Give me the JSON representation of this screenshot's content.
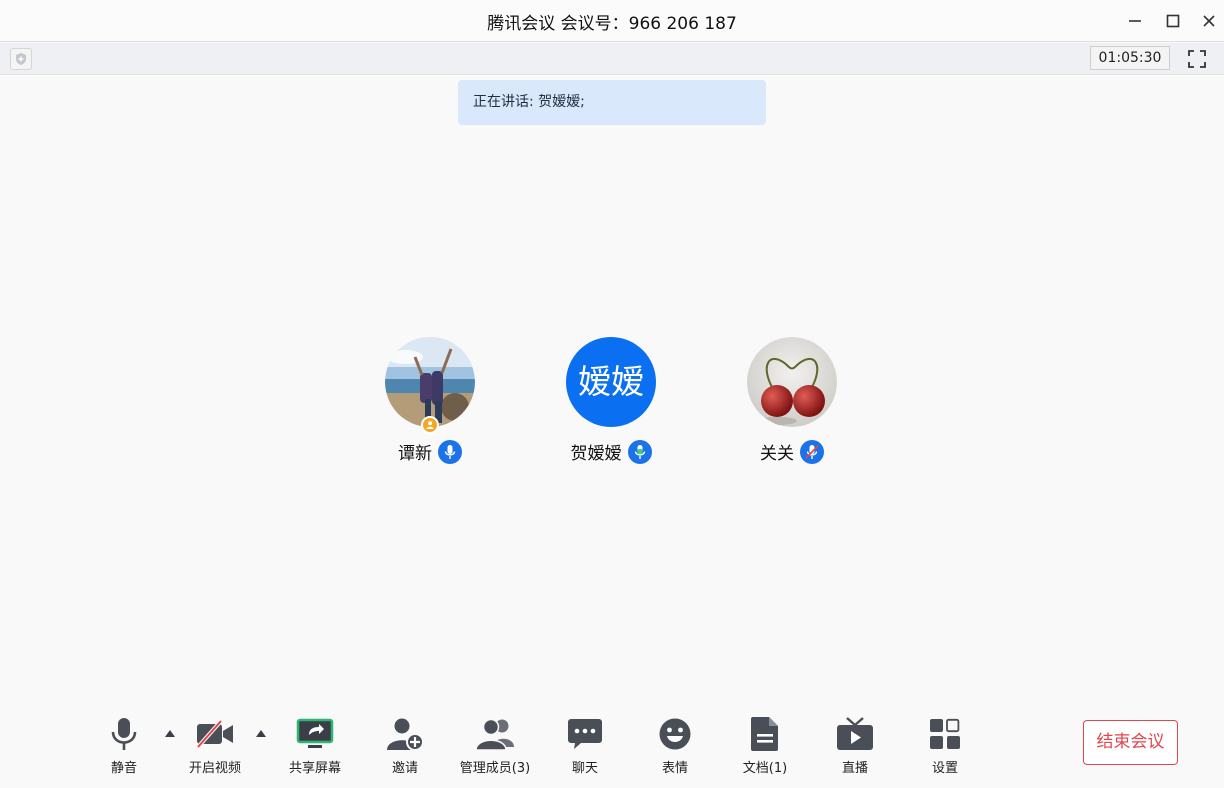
{
  "window": {
    "title": "腾讯会议 会议号：966 206 187"
  },
  "infobar": {
    "timer": "01:05:30"
  },
  "speaking": {
    "text": "正在讲话: 贺嫒嫒;"
  },
  "participants": [
    {
      "name": "谭新",
      "avatar_type": "photo-family",
      "is_host": true,
      "mic": "on"
    },
    {
      "name": "贺嫒嫒",
      "avatar_text": "嫒嫒",
      "avatar_color": "#0a6ff0",
      "mic": "speaking"
    },
    {
      "name": "关关",
      "avatar_type": "photo-cherries",
      "mic": "muted"
    }
  ],
  "toolbar": {
    "items": [
      {
        "label": "静音",
        "icon": "microphone-icon"
      },
      {
        "label": "开启视频",
        "icon": "video-off-icon"
      },
      {
        "label": "共享屏幕",
        "icon": "share-screen-icon"
      },
      {
        "label": "邀请",
        "icon": "add-person-icon"
      },
      {
        "label": "管理成员(3)",
        "icon": "members-icon"
      },
      {
        "label": "聊天",
        "icon": "chat-icon"
      },
      {
        "label": "表情",
        "icon": "emoji-icon"
      },
      {
        "label": "文档(1)",
        "icon": "document-icon"
      },
      {
        "label": "直播",
        "icon": "live-tv-icon"
      },
      {
        "label": "设置",
        "icon": "settings-grid-icon"
      }
    ],
    "end_label": "结束会议"
  },
  "colors": {
    "accent": "#1c72e8",
    "danger": "#e0474c",
    "speaking_bg": "#d9e8fa",
    "share_green": "#2bb673"
  }
}
